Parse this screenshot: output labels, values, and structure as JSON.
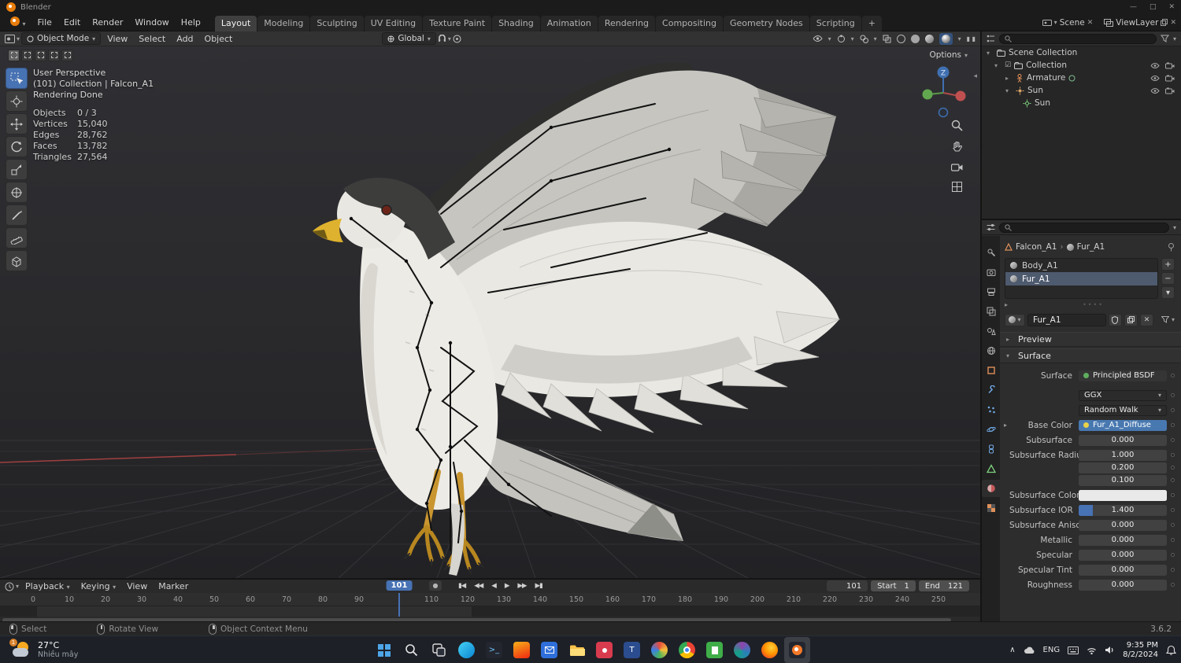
{
  "window": {
    "title": "Blender"
  },
  "theme": {
    "accent_blue": "#4772b3",
    "selection_blue": "#4878b0",
    "blender_orange": "#e87d0d"
  },
  "icons": {
    "chevron_down": "▾",
    "chevron_right": "▸",
    "chevron_left": "◂",
    "close": "✕",
    "plus": "+",
    "minus": "−",
    "record": "●",
    "jump_start": "▮◀",
    "key_prev": "◀◀",
    "play_back": "◀",
    "play": "▶",
    "key_next": "▶▶",
    "jump_end": "▶▮",
    "pause_bars": "▮ ▮",
    "grip_dots": "••••",
    "checkbox_checked": "☑",
    "breadcrumb_sep": "›",
    "minimize": "—",
    "maximize": "□",
    "tray_chevron_up": "∧"
  },
  "topbar": {
    "menus": [
      "File",
      "Edit",
      "Render",
      "Window",
      "Help"
    ],
    "workspaces": [
      "Layout",
      "Modeling",
      "Sculpting",
      "UV Editing",
      "Texture Paint",
      "Shading",
      "Animation",
      "Rendering",
      "Compositing",
      "Geometry Nodes",
      "Scripting"
    ],
    "active_workspace": "Layout",
    "add_workspace": "+",
    "scene_name": "Scene",
    "viewlayer_name": "ViewLayer"
  },
  "viewport": {
    "header": {
      "mode": "Object Mode",
      "menus": [
        "View",
        "Select",
        "Add",
        "Object"
      ],
      "orientation": "Global",
      "options": "Options"
    },
    "overlay": {
      "line1": "User Perspective",
      "line2": "(101) Collection | Falcon_A1",
      "line3": "Rendering Done",
      "stats": [
        {
          "label": "Objects",
          "value": "0 / 3"
        },
        {
          "label": "Vertices",
          "value": "15,040"
        },
        {
          "label": "Edges",
          "value": "28,762"
        },
        {
          "label": "Faces",
          "value": "13,782"
        },
        {
          "label": "Triangles",
          "value": "27,564"
        }
      ]
    },
    "gizmo_axis_label": "Z",
    "tools": [
      "select-box",
      "cursor",
      "move",
      "rotate",
      "scale",
      "transform",
      "annotate",
      "measure",
      "add-cube"
    ],
    "side_icons": [
      "zoom",
      "pan-hand",
      "camera-view",
      "toggle-ortho"
    ]
  },
  "outliner": {
    "items": [
      {
        "label": "Scene Collection"
      },
      {
        "label": "Collection"
      },
      {
        "label": "Armature"
      },
      {
        "label": "Sun"
      },
      {
        "label": "Sun"
      }
    ]
  },
  "properties": {
    "tabs": [
      "tool",
      "render",
      "output",
      "view-layer",
      "scene",
      "world",
      "object",
      "modifiers",
      "particles",
      "physics",
      "constraints",
      "object-data",
      "material",
      "texture"
    ],
    "active_tab": "material",
    "breadcrumb": {
      "object": "Falcon_A1",
      "material": "Fur_A1"
    },
    "slots": [
      {
        "name": "Body_A1"
      },
      {
        "name": "Fur_A1"
      }
    ],
    "material_name": "Fur_A1",
    "preview_label": "Preview",
    "surface_label": "Surface",
    "surface": {
      "label": "Surface",
      "shader": "Principled BSDF"
    },
    "distribution": "GGX",
    "subsurface_method": "Random Walk",
    "base_color": {
      "label": "Base Color",
      "texture": "Fur_A1_Diffuse"
    },
    "fields": [
      {
        "label": "Subsurface",
        "value": "0.000"
      },
      {
        "label": "Subsurface Radius",
        "value": "1.000"
      },
      {
        "label": "",
        "value": "0.200"
      },
      {
        "label": "",
        "value": "0.100"
      },
      {
        "label": "Subsurface Color",
        "value": ""
      },
      {
        "label": "Subsurface IOR",
        "value": "1.400"
      },
      {
        "label": "Subsurface Aniso...",
        "value": "0.000"
      },
      {
        "label": "Metallic",
        "value": "0.000"
      },
      {
        "label": "Specular",
        "value": "0.000"
      },
      {
        "label": "Specular Tint",
        "value": "0.000"
      },
      {
        "label": "Roughness",
        "value": "0.000"
      }
    ]
  },
  "timeline": {
    "menus": [
      "Playback",
      "Keying",
      "View",
      "Marker"
    ],
    "current_frame": "101",
    "frame_field": "101",
    "start_label": "Start",
    "start_value": "1",
    "end_label": "End",
    "end_value": "121",
    "ticks": [
      "0",
      "10",
      "20",
      "30",
      "40",
      "50",
      "60",
      "70",
      "80",
      "90",
      "110",
      "120",
      "130",
      "140",
      "150",
      "160",
      "170",
      "180",
      "190",
      "200",
      "210",
      "220",
      "230",
      "240",
      "250"
    ]
  },
  "statusbar": {
    "select": "Select",
    "rotate": "Rotate View",
    "context": "Object Context Menu",
    "version": "3.6.2"
  },
  "taskbar": {
    "weather": {
      "temp": "27°C",
      "desc": "Nhiều mây",
      "badge": "1"
    },
    "apps": [
      "start",
      "search",
      "task-view",
      "edge",
      "terminal",
      "office-orange",
      "mail",
      "file-explorer",
      "media-red",
      "teams",
      "photos",
      "chrome",
      "green-app",
      "browser-colorful",
      "firefox",
      "blender"
    ],
    "tray": {
      "lang": "ENG",
      "time": "9:35 PM",
      "date": "8/2/2024"
    }
  }
}
